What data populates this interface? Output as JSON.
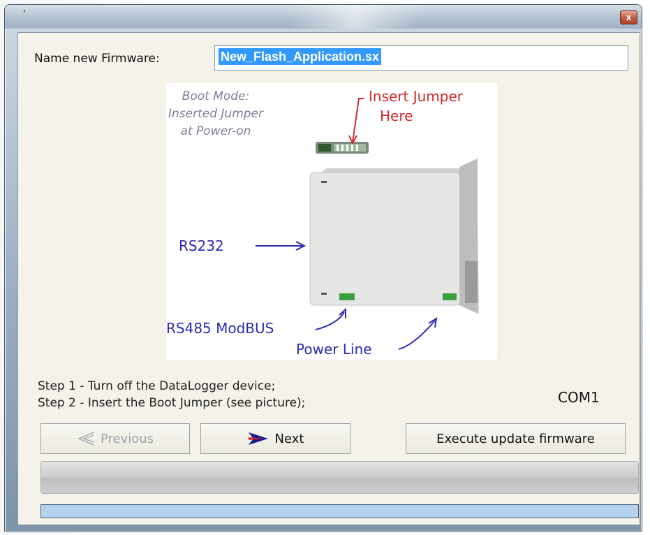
{
  "window": {
    "title": "'",
    "close_glyph": "x"
  },
  "firmware": {
    "label": "Name new Firmware:",
    "value": "New_Flash_Application.sx"
  },
  "picture": {
    "boot_mode_line1": "Boot Mode:",
    "boot_mode_line2": "Inserted Jumper",
    "boot_mode_line3": "at Power-on",
    "insert_jumper_line1": "Insert Jumper",
    "insert_jumper_line2": "Here",
    "rs232": "RS232",
    "rs485": "RS485 ModBUS",
    "power_line": "Power Line"
  },
  "steps": {
    "step1": "Step 1 - Turn off the DataLogger device;",
    "step2": "Step 2 - Insert the Boot Jumper (see picture);"
  },
  "port": "COM1",
  "buttons": {
    "previous": "Previous",
    "next": "Next",
    "execute": "Execute update firmware"
  },
  "progress": {
    "value_percent": 100
  },
  "colors": {
    "selection": "#3399ff",
    "annotation_blue": "#2b2bb5",
    "annotation_red": "#d12b2b",
    "annotation_gray": "#7d7d9a",
    "progress_fill": "#b4d1ee"
  }
}
